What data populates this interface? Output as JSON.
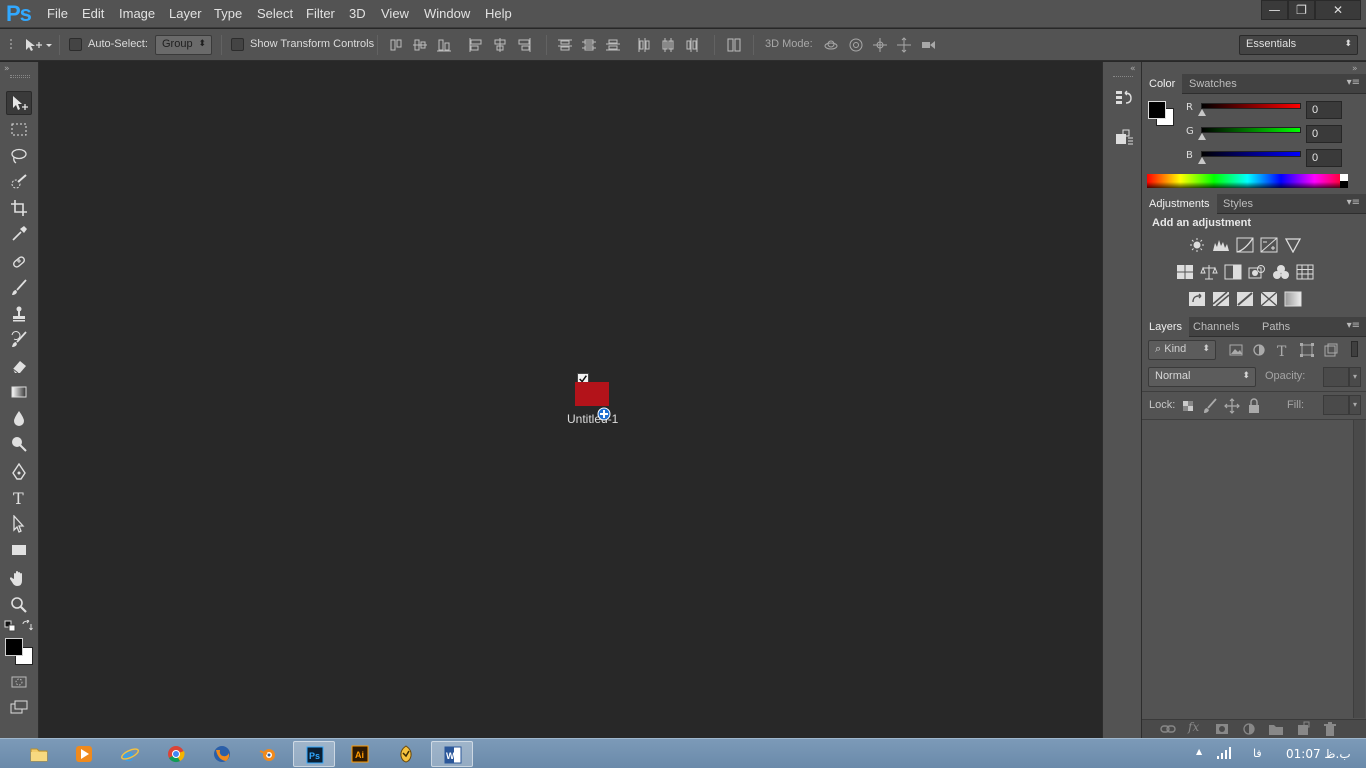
{
  "app": {
    "logo": "Ps"
  },
  "menu": [
    "File",
    "Edit",
    "Image",
    "Layer",
    "Type",
    "Select",
    "Filter",
    "3D",
    "View",
    "Window",
    "Help"
  ],
  "window_controls": {
    "minimize": "—",
    "restore": "❐",
    "close": "✕"
  },
  "options": {
    "auto_select_label": "Auto-Select:",
    "auto_select_value": "Group",
    "show_transform_label": "Show Transform Controls",
    "mode_3d_label": "3D Mode:",
    "workspace": "Essentials"
  },
  "canvas": {
    "document_name": "Untitled-1",
    "swatch_color": "#b3131a"
  },
  "color_panel": {
    "tabs": [
      "Color",
      "Swatches"
    ],
    "r_label": "R",
    "r_value": "0",
    "g_label": "G",
    "g_value": "0",
    "b_label": "B",
    "b_value": "0"
  },
  "adjustments_panel": {
    "tabs": [
      "Adjustments",
      "Styles"
    ],
    "heading": "Add an adjustment"
  },
  "layers_panel": {
    "tabs": [
      "Layers",
      "Channels",
      "Paths"
    ],
    "filter_kind": "Kind",
    "blend_mode": "Normal",
    "opacity_label": "Opacity:",
    "lock_label": "Lock:",
    "fill_label": "Fill:"
  },
  "taskbar": {
    "apps": [
      "file-explorer",
      "media-player",
      "internet-explorer",
      "chrome",
      "firefox",
      "blender",
      "photoshop",
      "illustrator",
      "fl-studio",
      "word"
    ],
    "lang": "فا",
    "time": "01:07 ب.ظ"
  },
  "colors": {
    "ui_bg": "#535353",
    "canvas_bg": "#282828",
    "accent": "#31a8ff"
  }
}
